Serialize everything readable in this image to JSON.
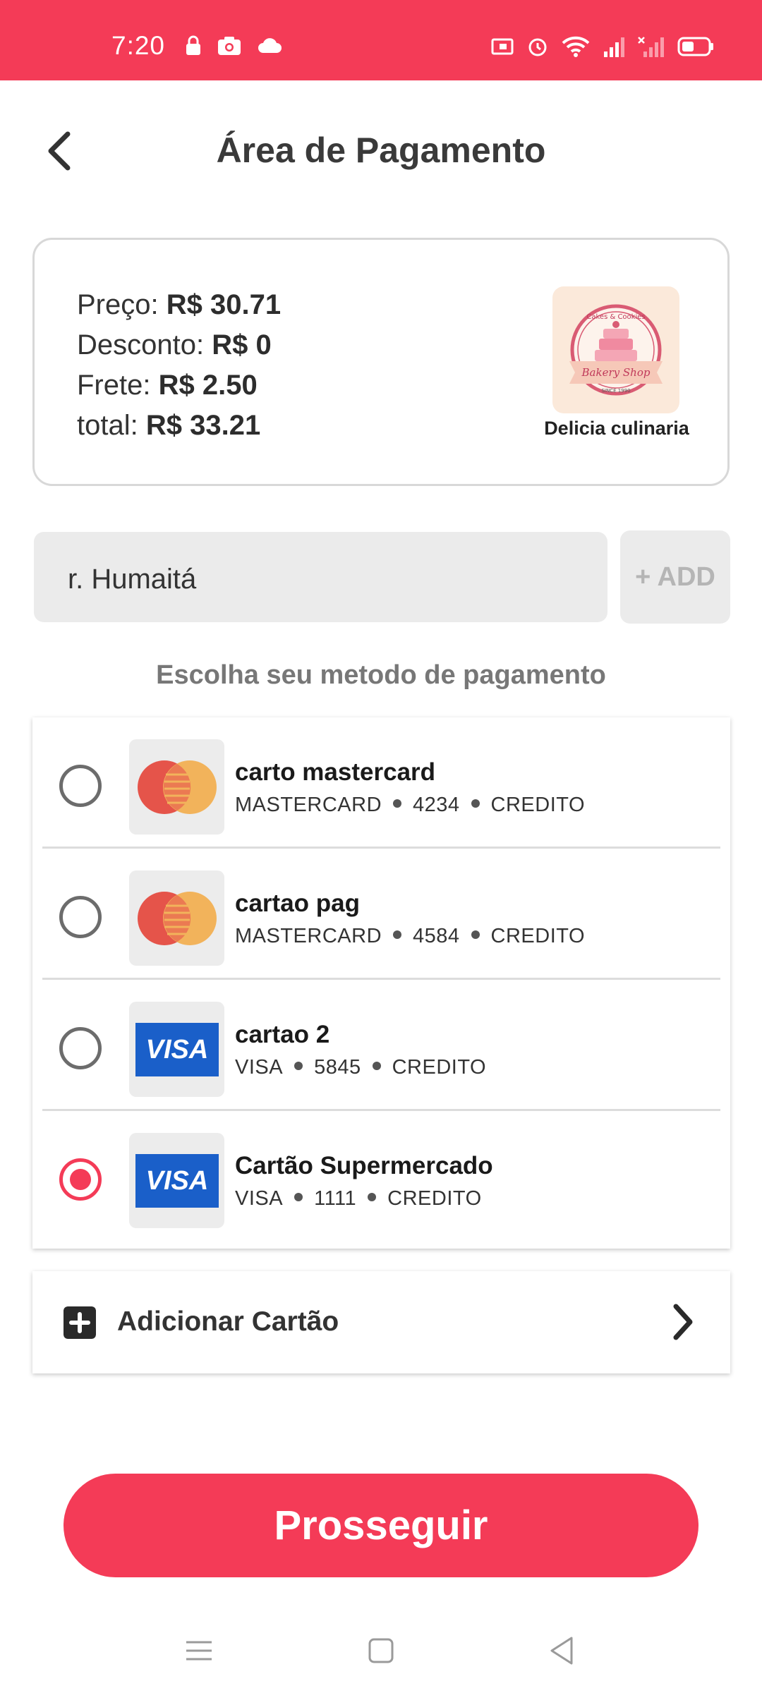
{
  "status_bar": {
    "time": "7:20",
    "left_icons": [
      "lock-icon",
      "camera-icon",
      "cloud-icon"
    ],
    "right_icons": [
      "cast-icon",
      "alarm-icon",
      "wifi-icon",
      "signal-icon",
      "signal-off-icon",
      "battery-icon"
    ]
  },
  "header": {
    "title": "Área de Pagamento",
    "back_icon": "chevron-left-icon"
  },
  "summary": {
    "price_label": "Preço:",
    "price_value": "R$ 30.71",
    "discount_label": "Desconto:",
    "discount_value": "R$ 0",
    "shipping_label": "Frete:",
    "shipping_value": "R$ 2.50",
    "total_label": "total:",
    "total_value": "R$ 33.21",
    "shop_name": "Delicia culinaria",
    "shop_logo_text_top": "Cakes & Cookies",
    "shop_logo_text_main": "Bakery Shop",
    "shop_logo_text_since": "SINCE 1990"
  },
  "address": {
    "value": "r. Humaitá",
    "add_label": "+ ADD"
  },
  "payment": {
    "section_label": "Escolha seu metodo de pagamento",
    "cards": [
      {
        "name": "carto mastercard",
        "brand": "MASTERCARD",
        "last4": "4234",
        "kind": "CREDITO",
        "logo": "mastercard",
        "selected": false
      },
      {
        "name": "cartao pag",
        "brand": "MASTERCARD",
        "last4": "4584",
        "kind": "CREDITO",
        "logo": "mastercard",
        "selected": false
      },
      {
        "name": "cartao 2",
        "brand": "VISA",
        "last4": "5845",
        "kind": "CREDITO",
        "logo": "visa",
        "selected": false
      },
      {
        "name": "Cartão Supermercado",
        "brand": "VISA",
        "last4": "1111",
        "kind": "CREDITO",
        "logo": "visa",
        "selected": true
      }
    ],
    "visa_logo_text": "VISA",
    "add_card_label": "Adicionar Cartão"
  },
  "actions": {
    "proceed_label": "Prosseguir"
  },
  "colors": {
    "accent": "#f43b57",
    "field_bg": "#ebebeb",
    "visa_blue": "#1a5fc9",
    "mc_red": "#e5544a",
    "mc_orange": "#f2b35b"
  },
  "nav_bar": [
    "menu-icon",
    "home-square-icon",
    "back-triangle-icon"
  ]
}
